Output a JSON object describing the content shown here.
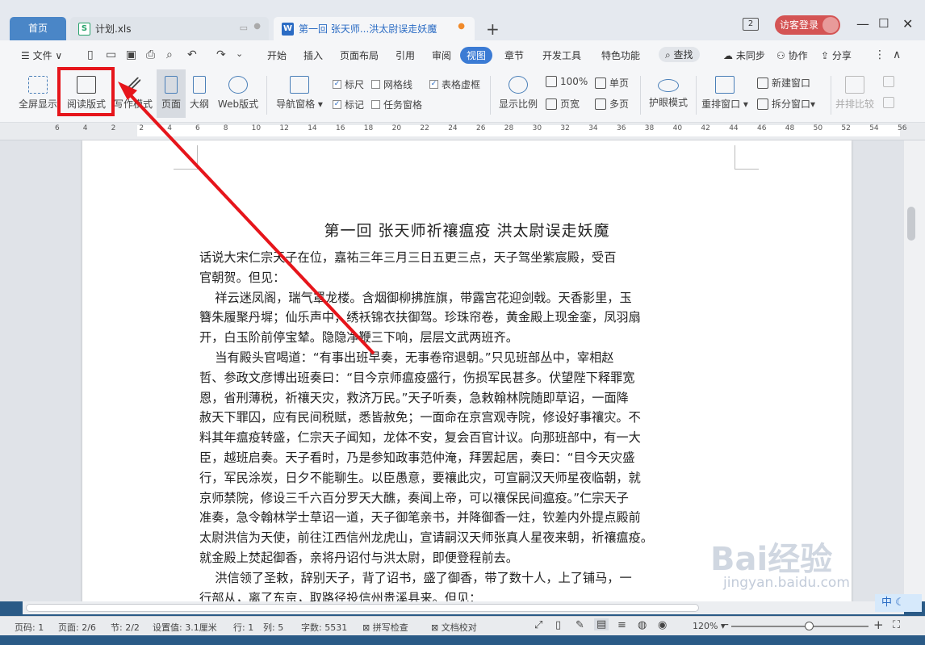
{
  "tabs": {
    "home": "首页",
    "xls": "计划.xls",
    "active": "第一回 张天师...洪太尉误走妖魔",
    "window_count": "2",
    "login": "访客登录"
  },
  "menu": {
    "file": "文件",
    "items": [
      "开始",
      "插入",
      "页面布局",
      "引用",
      "审阅",
      "视图",
      "章节",
      "开发工具",
      "特色功能"
    ],
    "selected": "视图",
    "search": "查找",
    "sync": "未同步",
    "collab": "协作",
    "share": "分享"
  },
  "ribbon": {
    "fullscreen": "全屏显示",
    "reading": "阅读版式",
    "writing": "写作模式",
    "page": "页面",
    "outline": "大纲",
    "web": "Web版式",
    "nav_pane": "导航窗格",
    "ruler": "标尺",
    "gridlines": "网格线",
    "table_border": "表格虚框",
    "marks": "标记",
    "task_pane": "任务窗格",
    "zoom_ratio": "显示比例",
    "zoom_100": "100%",
    "page_width": "页宽",
    "single_page": "单页",
    "multi_page": "多页",
    "eye_care": "护眼模式",
    "rearrange": "重排窗口",
    "new_window": "新建窗口",
    "split_window": "拆分窗口",
    "side_by_side": "并排比较"
  },
  "ruler_numbers": [
    "6",
    "4",
    "2",
    "2",
    "4",
    "6",
    "8",
    "10",
    "12",
    "14",
    "16",
    "18",
    "20",
    "22",
    "24",
    "26",
    "28",
    "30",
    "32",
    "34",
    "36",
    "38",
    "40",
    "42",
    "44",
    "46",
    "48",
    "50",
    "52",
    "54",
    "56"
  ],
  "document": {
    "title": "第一回  张天师祈禳瘟疫    洪太尉误走妖魔",
    "lines": [
      "话说大宋仁宗天子在位，嘉祐三年三月三日五更三点，天子驾坐紫宸殿，受百",
      "官朝贺。但见：",
      "    祥云迷凤阁，瑞气罩龙楼。含烟御柳拂旌旗，带露宫花迎剑戟。天香影里，玉",
      "簪朱履聚丹墀；仙乐声中，绣袄锦衣扶御驾。珍珠帘卷，黄金殿上现金銮，凤羽扇",
      "开，白玉阶前停宝辇。隐隐净鞭三下响，层层文武两班齐。",
      "    当有殿头官喝道：“有事出班早奏，无事卷帘退朝。”只见班部丛中，宰相赵",
      "哲、参政文彦博出班奏曰：“目今京师瘟疫盛行，伤损军民甚多。伏望陛下释罪宽",
      "恩，省刑薄税，祈禳天灾，救济万民。”天子听奏，急敕翰林院随即草诏，一面降",
      "赦天下罪囚，应有民间税赋，悉皆赦免；一面命在京宫观寺院，修设好事禳灾。不",
      "料其年瘟疫转盛，仁宗天子闻知，龙体不安，复会百官计议。向那班部中，有一大",
      "臣，越班启奏。天子看时，乃是参知政事范仲淹，拜罢起居，奏曰：“目今天灾盛",
      "行，军民涂炭，日夕不能聊生。以臣愚意，要禳此灾，可宣嗣汉天师星夜临朝，就",
      "京师禁院，修设三千六百分罗天大醮，奏闻上帝，可以禳保民间瘟疫。”仁宗天子",
      "准奏，急令翰林学士草诏一道，天子御笔亲书，并降御香一炷，钦差内外提点殿前",
      "太尉洪信为天使，前往江西信州龙虎山，宣请嗣汉天师张真人星夜来朝，祈禳瘟疫。",
      "就金殿上焚起御香，亲将丹诏付与洪太尉，即便登程前去。",
      "    洪信领了圣敕，辞别天子，背了诏书，盛了御香，带了数十人，上了铺马，一",
      "行部从，离了东京，取路径投信州贵溪县来。但见："
    ]
  },
  "status": {
    "page_num": "页码: 1",
    "pages": "页面: 2/6",
    "section": "节: 2/2",
    "setting": "设置值: 3.1厘米",
    "row": "行: 1",
    "col": "列: 5",
    "words": "字数: 5531",
    "spell": "拼写检查",
    "proof": "文档校对",
    "zoom": "120%"
  },
  "watermark": {
    "main": "Bai经验",
    "sub": "jingyan.baidu.com"
  },
  "ime": "中",
  "colors": {
    "accent": "#3b7bd4",
    "highlight": "#e6151b",
    "login": "#d45454"
  }
}
